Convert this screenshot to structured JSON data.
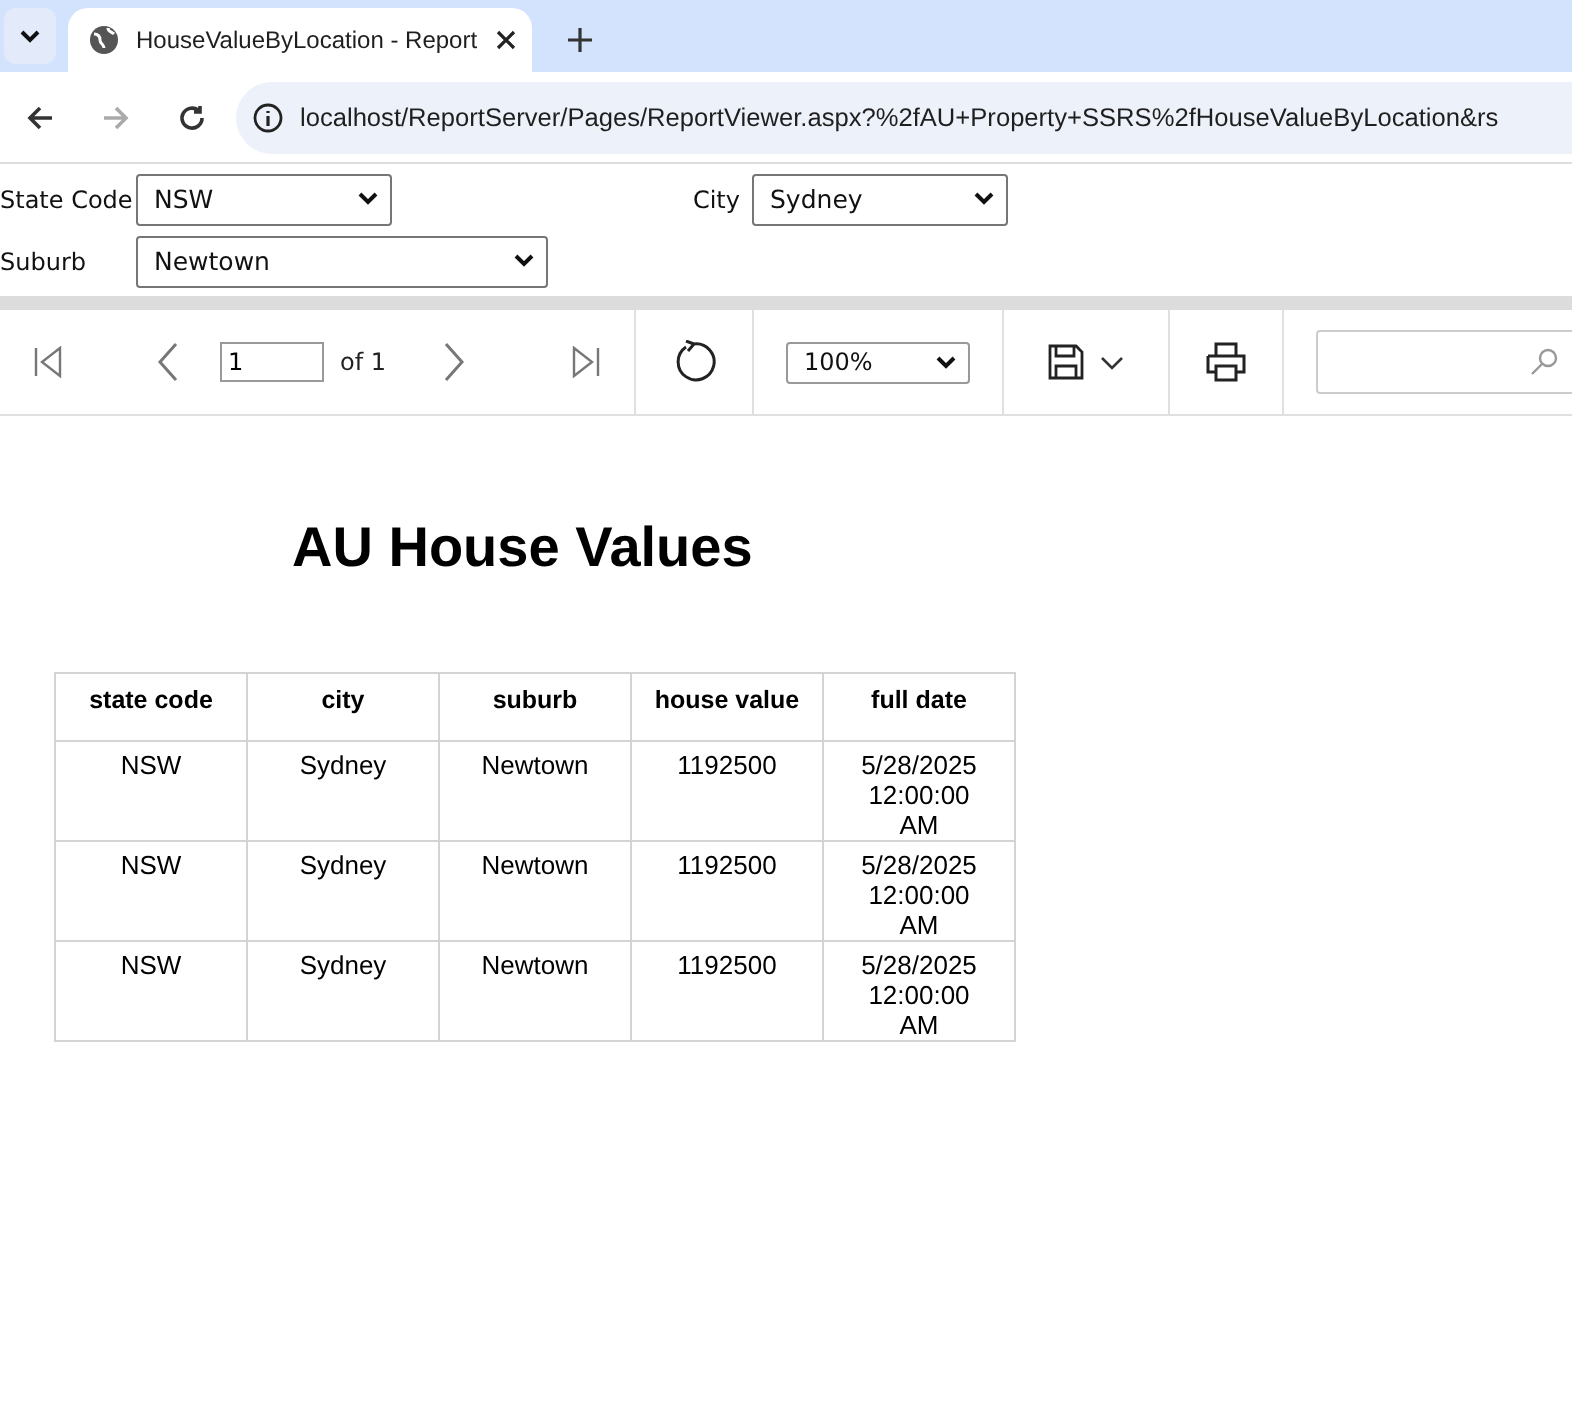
{
  "browser": {
    "tab_title": "HouseValueByLocation - Report",
    "url": "localhost/ReportServer/Pages/ReportViewer.aspx?%2fAU+Property+SSRS%2fHouseValueByLocation&rs"
  },
  "parameters": [
    {
      "label": "State Code",
      "value": "NSW"
    },
    {
      "label": "City",
      "value": "Sydney"
    },
    {
      "label": "Suburb",
      "value": "Newtown"
    }
  ],
  "toolbar": {
    "page": "1",
    "of_pages": "of 1",
    "zoom": "100%"
  },
  "report": {
    "title": "AU House Values",
    "columns": [
      "state code",
      "city",
      "suburb",
      "house value",
      "full date"
    ],
    "rows": [
      [
        "NSW",
        "Sydney",
        "Newtown",
        "1192500",
        "5/28/2025 12:00:00 AM"
      ],
      [
        "NSW",
        "Sydney",
        "Newtown",
        "1192500",
        "5/28/2025 12:00:00 AM"
      ],
      [
        "NSW",
        "Sydney",
        "Newtown",
        "1192500",
        "5/28/2025 12:00:00 AM"
      ]
    ]
  }
}
